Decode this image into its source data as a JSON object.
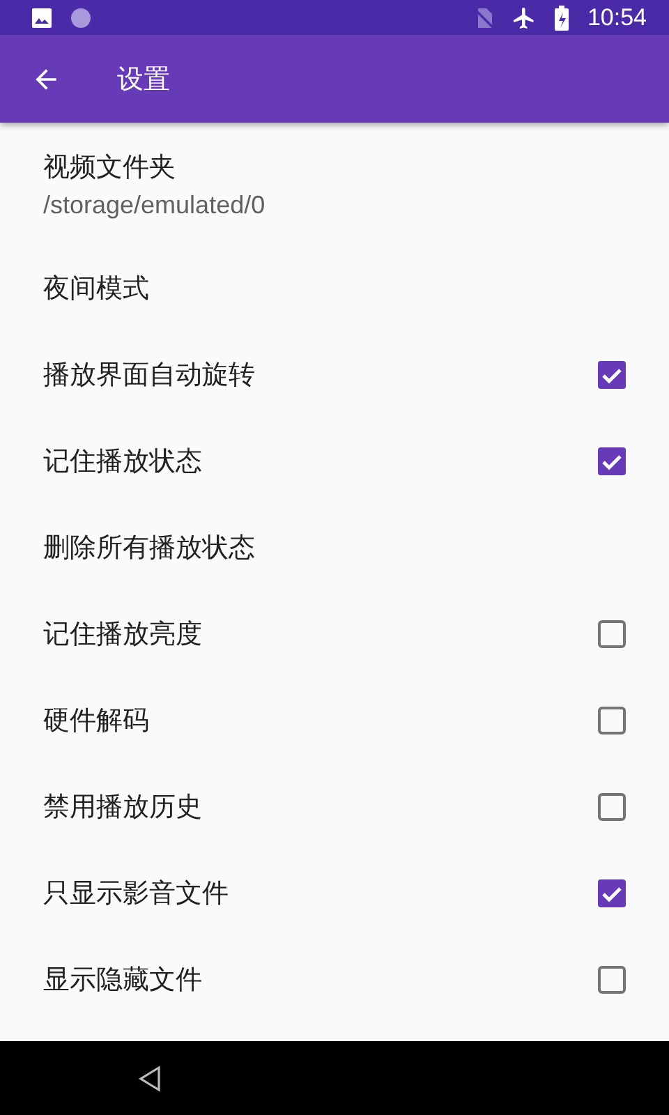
{
  "status_bar": {
    "time": "10:54"
  },
  "app_bar": {
    "title": "设置"
  },
  "settings": [
    {
      "kind": "summary",
      "title": "视频文件夹",
      "summary": "/storage/emulated/0"
    },
    {
      "kind": "plain",
      "title": "夜间模式"
    },
    {
      "kind": "checkbox",
      "title": "播放界面自动旋转",
      "checked": true
    },
    {
      "kind": "checkbox",
      "title": "记住播放状态",
      "checked": true
    },
    {
      "kind": "plain",
      "title": "删除所有播放状态"
    },
    {
      "kind": "checkbox",
      "title": "记住播放亮度",
      "checked": false
    },
    {
      "kind": "checkbox",
      "title": "硬件解码",
      "checked": false
    },
    {
      "kind": "checkbox",
      "title": "禁用播放历史",
      "checked": false
    },
    {
      "kind": "checkbox",
      "title": "只显示影音文件",
      "checked": true
    },
    {
      "kind": "checkbox",
      "title": "显示隐藏文件",
      "checked": false
    }
  ]
}
